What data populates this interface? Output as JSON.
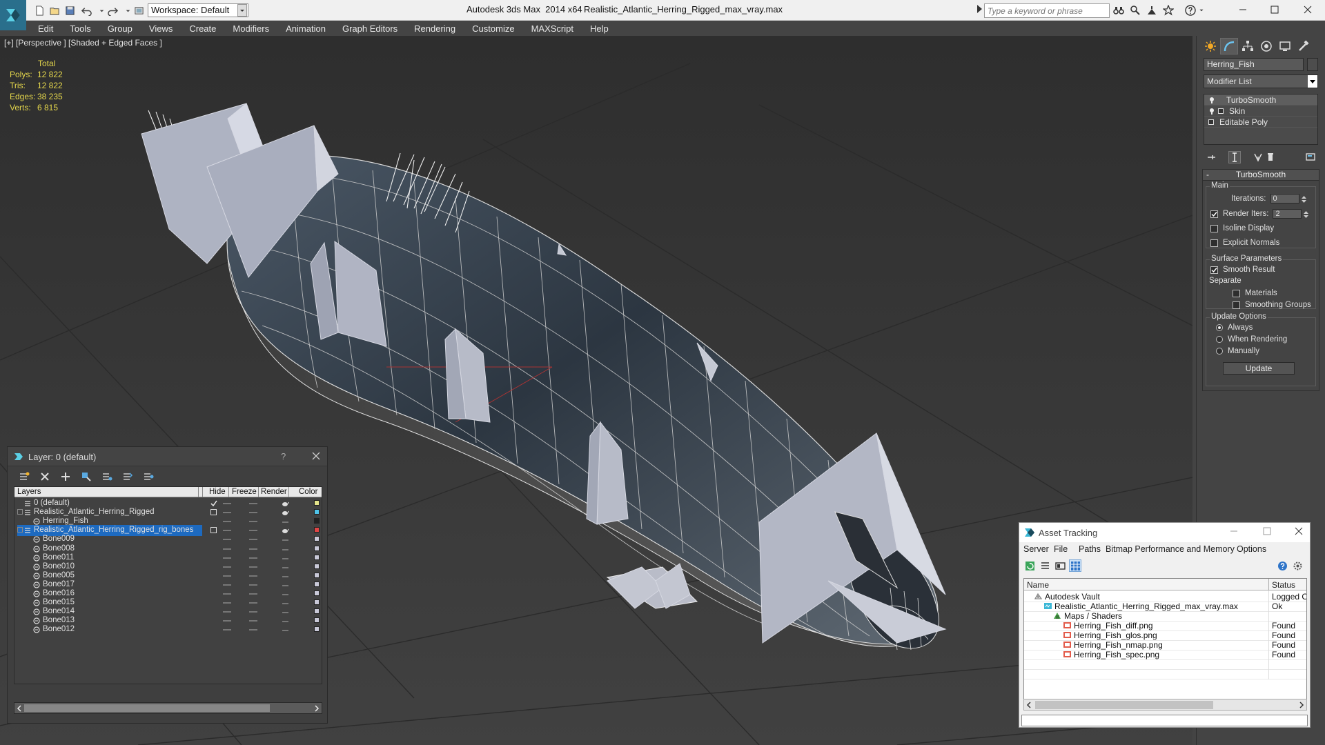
{
  "window": {
    "app_title": "Autodesk 3ds Max  2014 x64",
    "file_name": "Realistic_Atlantic_Herring_Rigged_max_vray.max",
    "workspace_label": "Workspace: Default",
    "search_placeholder": "Type a keyword or phrase"
  },
  "menu": [
    "Edit",
    "Tools",
    "Group",
    "Views",
    "Create",
    "Modifiers",
    "Animation",
    "Graph Editors",
    "Rendering",
    "Customize",
    "MAXScript",
    "Help"
  ],
  "viewport": {
    "label": "[+] [Perspective ] [Shaded + Edged Faces ]",
    "stats_header": "Total",
    "stats": [
      {
        "label": "Polys:",
        "value": "12 822"
      },
      {
        "label": "Tris:",
        "value": "12 822"
      },
      {
        "label": "Edges:",
        "value": "38 235"
      },
      {
        "label": "Verts:",
        "value": "6 815"
      }
    ]
  },
  "command_panel": {
    "object_name": "Herring_Fish",
    "modifier_list_label": "Modifier List",
    "stack": [
      "TurboSmooth",
      "Skin",
      "Editable Poly"
    ],
    "rollout": {
      "title": "TurboSmooth",
      "minus": "-",
      "main_group": "Main",
      "iterations_label": "Iterations:",
      "iterations_value": "0",
      "render_iters_label": "Render Iters:",
      "render_iters_value": "2",
      "isoline_label": "Isoline Display",
      "explicit_normals_label": "Explicit Normals",
      "surface_group": "Surface Parameters",
      "smooth_result_label": "Smooth Result",
      "separate_label": "Separate",
      "materials_label": "Materials",
      "smoothing_groups_label": "Smoothing Groups",
      "update_group": "Update Options",
      "always_label": "Always",
      "when_rendering_label": "When Rendering",
      "manually_label": "Manually",
      "update_button": "Update"
    }
  },
  "layer_manager": {
    "title": "Layer: 0 (default)",
    "help_glyph": "?",
    "columns": {
      "layers": "Layers",
      "hide": "Hide",
      "freeze": "Freeze",
      "render": "Render",
      "color": "Color"
    },
    "rows": [
      {
        "name": "0 (default)",
        "indent": 1,
        "type": "layer",
        "color": "#e3e38a",
        "check": true
      },
      {
        "name": "Realistic_Atlantic_Herring_Rigged",
        "indent": 1,
        "type": "layer",
        "color": "#4fc3e8",
        "box": true
      },
      {
        "name": "Herring_Fish",
        "indent": 2,
        "type": "object",
        "color": "#222222"
      },
      {
        "name": "Realistic_Atlantic_Herring_Rigged_rig_bones",
        "indent": 1,
        "type": "layer",
        "color": "#e04545",
        "box": true,
        "selected": true
      },
      {
        "name": "Bone009",
        "indent": 2,
        "type": "object",
        "color": "#c9c9d8"
      },
      {
        "name": "Bone008",
        "indent": 2,
        "type": "object",
        "color": "#c9c9d8"
      },
      {
        "name": "Bone011",
        "indent": 2,
        "type": "object",
        "color": "#c9c9d8"
      },
      {
        "name": "Bone010",
        "indent": 2,
        "type": "object",
        "color": "#c9c9d8"
      },
      {
        "name": "Bone005",
        "indent": 2,
        "type": "object",
        "color": "#c9c9d8"
      },
      {
        "name": "Bone017",
        "indent": 2,
        "type": "object",
        "color": "#c9c9d8"
      },
      {
        "name": "Bone016",
        "indent": 2,
        "type": "object",
        "color": "#c9c9d8"
      },
      {
        "name": "Bone015",
        "indent": 2,
        "type": "object",
        "color": "#c9c9d8"
      },
      {
        "name": "Bone014",
        "indent": 2,
        "type": "object",
        "color": "#c9c9d8"
      },
      {
        "name": "Bone013",
        "indent": 2,
        "type": "object",
        "color": "#c9c9d8"
      },
      {
        "name": "Bone012",
        "indent": 2,
        "type": "object",
        "color": "#c9c9d8"
      }
    ]
  },
  "asset_tracking": {
    "title": "Asset Tracking",
    "menu": [
      "Server",
      "File",
      "Paths",
      "Bitmap Performance and Memory",
      "Options"
    ],
    "columns": {
      "name": "Name",
      "status": "Status"
    },
    "rows": [
      {
        "name": "Autodesk Vault",
        "status": "Logged Ou",
        "indent": 0,
        "icon": "vault"
      },
      {
        "name": "Realistic_Atlantic_Herring_Rigged_max_vray.max",
        "status": "Ok",
        "indent": 1,
        "icon": "max"
      },
      {
        "name": "Maps / Shaders",
        "status": "",
        "indent": 2,
        "icon": "maps"
      },
      {
        "name": "Herring_Fish_diff.png",
        "status": "Found",
        "indent": 3,
        "icon": "png"
      },
      {
        "name": "Herring_Fish_glos.png",
        "status": "Found",
        "indent": 3,
        "icon": "png"
      },
      {
        "name": "Herring_Fish_nmap.png",
        "status": "Found",
        "indent": 3,
        "icon": "png"
      },
      {
        "name": "Herring_Fish_spec.png",
        "status": "Found",
        "indent": 3,
        "icon": "png"
      }
    ]
  },
  "colors": {
    "viewport_bg": "#3a3a3a",
    "panel_bg": "#444444",
    "selection_blue": "#1d6ac0",
    "stats_yellow": "#e6d84c"
  }
}
